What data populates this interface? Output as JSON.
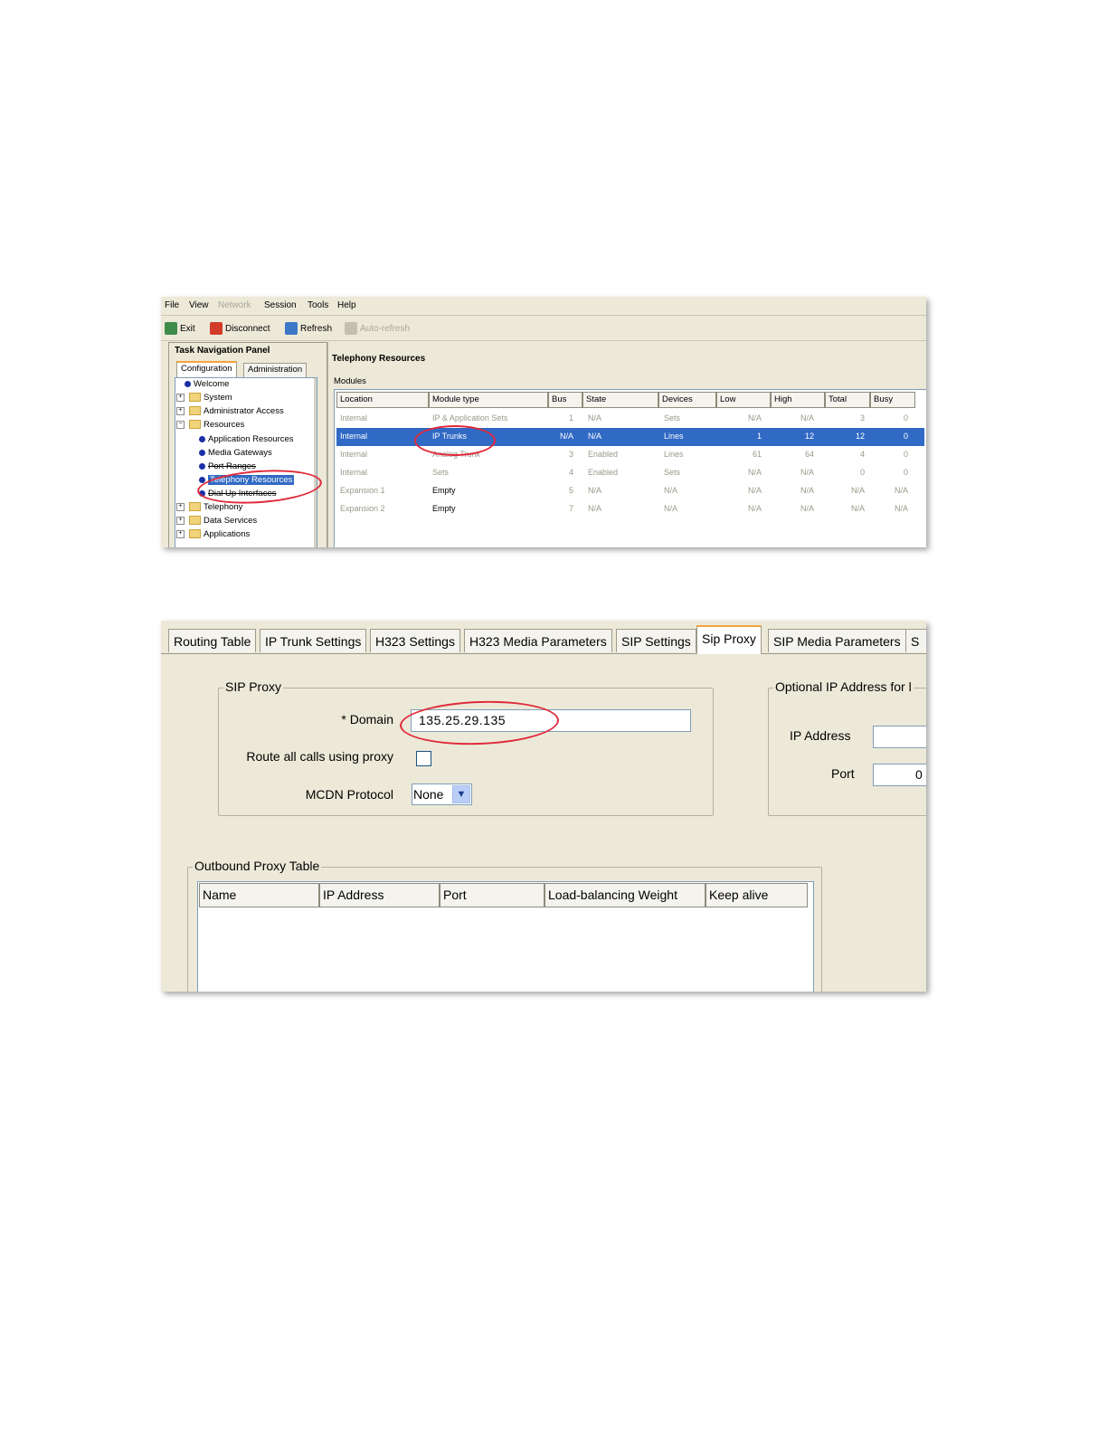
{
  "top_window": {
    "menu": [
      "File",
      "View",
      "Network",
      "Session",
      "Tools",
      "Help"
    ],
    "menu_disabled": [
      "Network"
    ],
    "toolbar": {
      "exit": "Exit",
      "disconnect": "Disconnect",
      "refresh": "Refresh",
      "auto_refresh": "Auto-refresh"
    },
    "nav_panel": {
      "title": "Task Navigation Panel",
      "tabs": [
        "Configuration",
        "Administration"
      ],
      "active_tab": "Configuration",
      "tree": [
        {
          "label": "Welcome",
          "type": "leaf"
        },
        {
          "label": "System",
          "type": "folder"
        },
        {
          "label": "Administrator Access",
          "type": "folder"
        },
        {
          "label": "Resources",
          "type": "folder",
          "expanded": true
        },
        {
          "label": "Application Resources",
          "type": "leaf"
        },
        {
          "label": "Media Gateways",
          "type": "leaf"
        },
        {
          "label": "Port Ranges",
          "type": "leaf"
        },
        {
          "label": "Telephony Resources",
          "type": "leaf",
          "selected": true
        },
        {
          "label": "Dial Up Interfaces",
          "type": "leaf"
        },
        {
          "label": "Telephony",
          "type": "folder"
        },
        {
          "label": "Data Services",
          "type": "folder"
        },
        {
          "label": "Applications",
          "type": "folder"
        }
      ]
    },
    "main": {
      "title": "Telephony Resources",
      "modules_label": "Modules",
      "columns": [
        "Location",
        "Module type",
        "Bus",
        "State",
        "Devices",
        "Low",
        "High",
        "Total",
        "Busy"
      ],
      "rows": [
        [
          "Internal",
          "IP & Application Sets",
          "1",
          "N/A",
          "Sets",
          "N/A",
          "N/A",
          "3",
          "0"
        ],
        [
          "Internal",
          "IP Trunks",
          "N/A",
          "N/A",
          "Lines",
          "1",
          "12",
          "12",
          "0"
        ],
        [
          "Internal",
          "Analog Trunk",
          "3",
          "Enabled",
          "Lines",
          "61",
          "64",
          "4",
          "0"
        ],
        [
          "Internal",
          "Sets",
          "4",
          "Enabled",
          "Sets",
          "N/A",
          "N/A",
          "0",
          "0"
        ],
        [
          "Expansion 1",
          "Empty",
          "5",
          "N/A",
          "N/A",
          "N/A",
          "N/A",
          "N/A",
          "N/A"
        ],
        [
          "Expansion 2",
          "Empty",
          "7",
          "N/A",
          "N/A",
          "N/A",
          "N/A",
          "N/A",
          "N/A"
        ]
      ],
      "selected_row": 1
    },
    "highlight_color": "#e0293a",
    "selection_color": "#316ac5"
  },
  "bottom_window": {
    "tabs": [
      "Routing Table",
      "IP Trunk Settings",
      "H323 Settings",
      "H323 Media Parameters",
      "SIP Settings",
      "Sip Proxy",
      "SIP Media Parameters",
      "S"
    ],
    "active_tab": "Sip Proxy",
    "sip_proxy": {
      "legend": "SIP Proxy",
      "domain_label": "* Domain",
      "domain_value": "135.25.29.135",
      "route_label": "Route all calls using proxy",
      "route_checked": false,
      "mcdn_label": "MCDN Protocol",
      "mcdn_value": "None"
    },
    "optional_ip": {
      "legend": "Optional IP Address for l",
      "ip_label": "IP Address",
      "ip_value": "",
      "port_label": "Port",
      "port_value": "0"
    },
    "outbound_proxy": {
      "legend": "Outbound Proxy Table",
      "columns": [
        "Name",
        "IP Address",
        "Port",
        "Load-balancing Weight",
        "Keep alive"
      ]
    }
  }
}
